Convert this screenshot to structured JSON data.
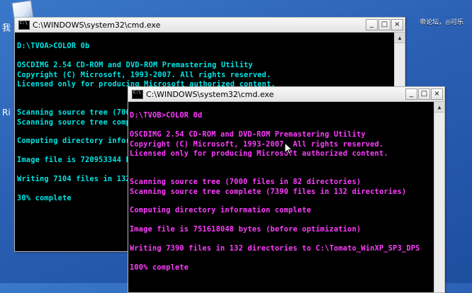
{
  "desktop": {
    "top_right_text": "帝论坛，◎可乐",
    "side_glyphs": [
      "我",
      "Ri"
    ]
  },
  "window1": {
    "title": "C:\\WINDOWS\\system32\\cmd.exe",
    "text_color": "#00e5e5",
    "lines": [
      "",
      "D:\\TVOA>COLOR 0b",
      "",
      "OSCDIMG 2.54 CD-ROM and DVD-ROM Premastering Utility",
      "Copyright (C) Microsoft, 1993-2007. All rights reserved.",
      "Licensed only for producing Microsoft authorized content.",
      "",
      "",
      "Scanning source tree (7000 files in 82 directories)",
      "Scanning source tree complete (7390 files in 132 directories)",
      "",
      "Computing directory information complete",
      "",
      "Image file is 720953344 bytes (before optimization)",
      "",
      "Writing 7104 files in 132 directories to C:\\Tomato_WinXP_SP3_DPS",
      "",
      "30% complete"
    ]
  },
  "window2": {
    "title": "C:\\WINDOWS\\system32\\cmd.exe",
    "text_color": "#ff3cff",
    "lines": [
      "",
      "D:\\TVOB>COLOR 0d",
      "",
      "OSCDIMG 2.54 CD-ROM and DVD-ROM Premastering Utility",
      "Copyright (C) Microsoft, 1993-2007. All rights reserved.",
      "Licensed only for producing Microsoft authorized content.",
      "",
      "",
      "Scanning source tree (7000 files in 82 directories)",
      "Scanning source tree complete (7390 files in 132 directories)",
      "",
      "Computing directory information complete",
      "",
      "Image file is 751618048 bytes (before optimization)",
      "",
      "Writing 7390 files in 132 directories to C:\\Tomato_WinXP_SP3_DPS",
      "",
      "100% complete"
    ]
  },
  "controls": {
    "minimize": "_",
    "maximize": "□",
    "close": "×"
  },
  "scroll": {
    "up": "▲"
  }
}
